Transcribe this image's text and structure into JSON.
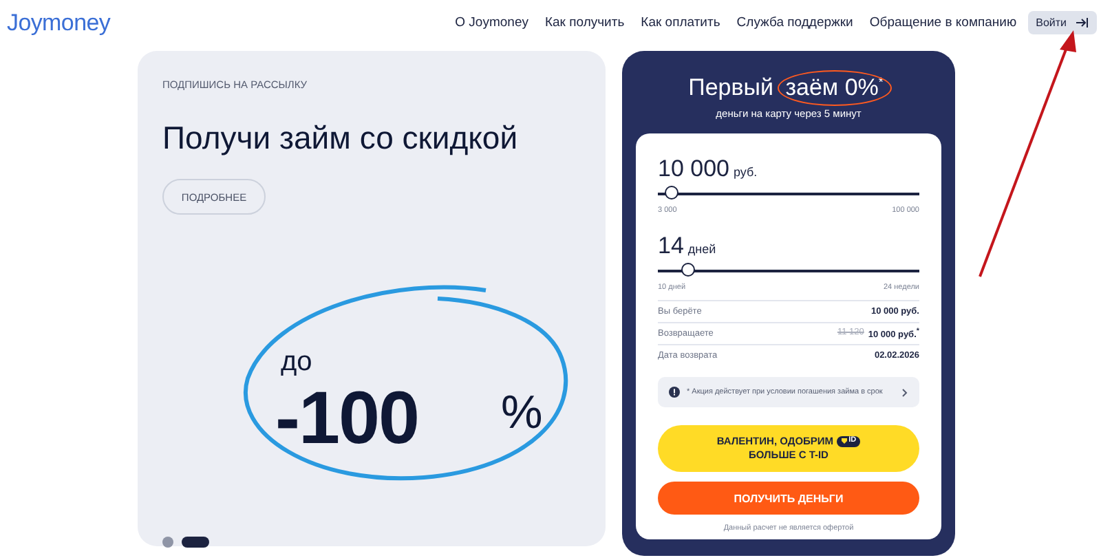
{
  "header": {
    "logo": "Joymoney",
    "nav": [
      "О Joymoney",
      "Как получить",
      "Как оплатить",
      "Служба поддержки",
      "Обращение в компанию"
    ],
    "login": "Войти"
  },
  "promo": {
    "eyebrow": "ПОДПИШИСЬ НА РАССЫЛКУ",
    "title": "Получи займ со скидкой",
    "button": "ПОДРОБНЕЕ",
    "prefix": "до",
    "value": "-100",
    "unit": "%",
    "dots": [
      {
        "selected": false
      },
      {
        "selected": true
      }
    ]
  },
  "calculator": {
    "title_lead": "Первый",
    "title_highlight": "заём 0%$^{*}$",
    "subtitle": "деньги на карту через 5 минут",
    "sliders": [
      {
        "value": "10 000",
        "unit": "руб.",
        "level": 0.06,
        "min": "3 000",
        "max": "100 000"
      },
      {
        "value": "14",
        "unit": "дней",
        "level": 0.12,
        "min": "10 дней",
        "max": "24 недели"
      }
    ],
    "rows": [
      {
        "label": "Вы берёте",
        "old": "",
        "value": "10 000 руб."
      },
      {
        "label": "Возвращаете",
        "old": "11 120",
        "value": "10 000 руб.$^{*}$"
      },
      {
        "label": "Дата возврата",
        "old": "",
        "value": "02.02.2026"
      }
    ],
    "notice": "* Акция действует при условии погашения займа в срок",
    "tid_button": {
      "lines": [
        "ВАЛЕНТИН, ОДОБРИМ",
        "БОЛЬШЕ С T-ID"
      ],
      "badge": "ID"
    },
    "submit": "ПОЛУЧИТЬ ДЕНЬГИ",
    "footnote": "Данный расчет не является офертой"
  }
}
